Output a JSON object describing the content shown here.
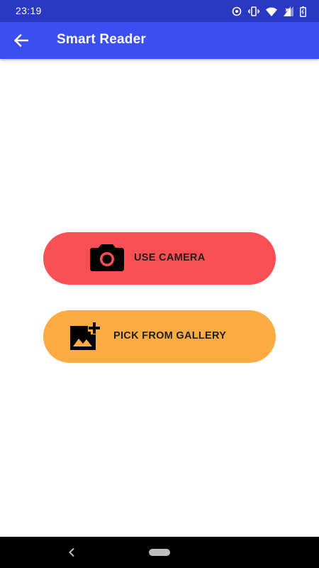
{
  "status_bar": {
    "time": "23:19",
    "icons": [
      "sync-icon",
      "vibrate-icon",
      "wifi-icon",
      "cellular-no-data-icon",
      "battery-icon"
    ]
  },
  "app_bar": {
    "title": "Smart Reader",
    "back_icon": "arrow-back-icon",
    "background": "#3a4ef2"
  },
  "actions": {
    "camera": {
      "label": "USE CAMERA",
      "icon": "camera-icon",
      "color": "#fb5053"
    },
    "gallery": {
      "label": "PICK FROM GALLERY",
      "icon": "add-photo-icon",
      "color": "#fdac43"
    }
  },
  "nav_bar": {
    "back_icon": "chevron-left-icon",
    "home_icon": "home-pill-icon"
  }
}
